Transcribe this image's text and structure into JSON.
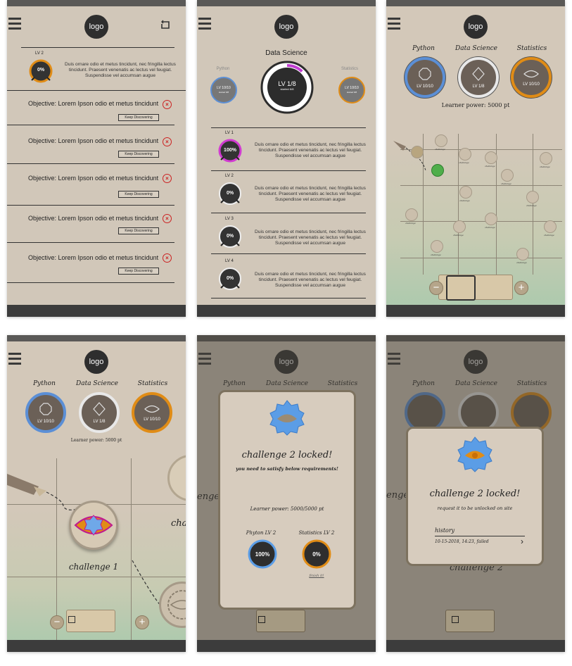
{
  "app": {
    "logo": "logo"
  },
  "p1": {
    "level_label": "LV 2",
    "percent": "0%",
    "description": "Duis ornare odio et metus tincidunt, nec fringilla lectus tincidunt. Praesent venenatis ac lectus vel feugiat. Suspendisse vel accumsan augue",
    "objectives": [
      {
        "text": "Objective: Lorem Ipson odio et metus tincidunt",
        "button": "Keep Discovering"
      },
      {
        "text": "Objective: Lorem Ipson odio et metus tincidunt",
        "button": "Keep Discovering"
      },
      {
        "text": "Objective: Lorem Ipson odio et metus tincidunt",
        "button": "Keep Discovering"
      },
      {
        "text": "Objective: Lorem Ipson odio et metus tincidunt",
        "button": "Keep Discovering"
      },
      {
        "text": "Objective: Lorem Ipson odio et metus tincidunt",
        "button": "Keep Discovering"
      }
    ]
  },
  "p2": {
    "title": "Data Science",
    "side_left": {
      "name": "Python",
      "level": "LV 10/10",
      "sub": "started 6/8"
    },
    "side_right": {
      "name": "Statistics",
      "level": "LV 10/10",
      "sub": "started 6/8"
    },
    "main": {
      "level": "LV 1/8",
      "sub": "started 6/8",
      "progress": 0.12
    },
    "levels": [
      {
        "label": "LV 1",
        "percent": "100%",
        "text": "Duis ornare odio et metus tincidunt, nec fringilla lectus tincidunt. Praesent venenatis ac lectus vel feugiat. Suspendisse vel accumsan augue"
      },
      {
        "label": "LV 2",
        "percent": "0%",
        "text": "Duis ornare odio et metus tincidunt, nec fringilla lectus tincidunt. Praesent venenatis ac lectus vel feugiat. Suspendisse vel accumsan augue"
      },
      {
        "label": "LV 3",
        "percent": "0%",
        "text": "Duis ornare odio et metus tincidunt, nec fringilla lectus tincidunt. Praesent venenatis ac lectus vel feugiat. Suspendisse vel accumsan augue"
      },
      {
        "label": "LV 4",
        "percent": "0%",
        "text": "Duis ornare odio et metus tincidunt, nec fringilla lectus tincidunt. Praesent venenatis ac lectus vel feugiat. Suspendisse vel accumsan augue"
      }
    ]
  },
  "subjects": [
    {
      "name": "Python",
      "level": "LV 10/10",
      "color": "#5b8fd6",
      "icon": "octagon-icon"
    },
    {
      "name": "Data Science",
      "level": "LV 1/8",
      "color": "#e8e8e8",
      "icon": "diamond-icon"
    },
    {
      "name": "Statistics",
      "level": "LV 10/10",
      "color": "#e08c16",
      "icon": "eye-icon"
    }
  ],
  "p3": {
    "learner_power": "Learner power: 5000 pt",
    "node_label": "challenge"
  },
  "p4": {
    "learner_power": "Learner power: 5000 pt",
    "challenge_name": "challenge 1",
    "side_label": "cha"
  },
  "p5": {
    "title": "challenge 2 locked!",
    "subtitle": "you need to satisfy below requirements!",
    "learner_power": "Learner power: 5000/5000 pt",
    "req1": {
      "label": "Phyton LV 2",
      "percent": "100%"
    },
    "req2": {
      "label": "Statistics LV 2",
      "percent": "0%",
      "link": "finish it!"
    },
    "bg_label": "enge"
  },
  "p6": {
    "title": "challenge 2 locked!",
    "subtitle": "request it to be unlocked on site",
    "history_label": "history",
    "history_entry": "10-15-2018, 14:23, failed",
    "bg_label": "enge",
    "bg_challenge": "challenge 2"
  }
}
